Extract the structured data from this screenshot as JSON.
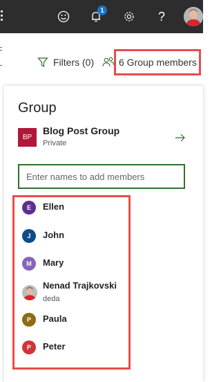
{
  "topbar": {
    "notifications_count": "1",
    "icons": [
      "smiley-icon",
      "bell-icon",
      "gear-icon",
      "help-icon",
      "user-avatar"
    ]
  },
  "command_bar": {
    "filters_label": "Filters (0)",
    "members_label": "6 Group members"
  },
  "panel": {
    "title": "Group",
    "group": {
      "initials": "BP",
      "name": "Blog Post Group",
      "privacy": "Private",
      "logo_color": "#b0173a"
    },
    "add_members_placeholder": "Enter names to add members",
    "members": [
      {
        "initial": "E",
        "name": "Ellen",
        "subtitle": "",
        "color": "#5c2e91"
      },
      {
        "initial": "J",
        "name": "John",
        "subtitle": "",
        "color": "#0f4d8a"
      },
      {
        "initial": "M",
        "name": "Mary",
        "subtitle": "",
        "color": "#8764b8"
      },
      {
        "initial": "",
        "name": "Nenad Trajkovski",
        "subtitle": "deda",
        "color": "#c9c9c9"
      },
      {
        "initial": "P",
        "name": "Paula",
        "subtitle": "",
        "color": "#8e6c15"
      },
      {
        "initial": "P",
        "name": "Peter",
        "subtitle": "",
        "color": "#d13438"
      }
    ]
  },
  "colors": {
    "highlight": "#e84c4c",
    "input_border": "#2f6e2f",
    "topbar": "#2d2d2d"
  }
}
